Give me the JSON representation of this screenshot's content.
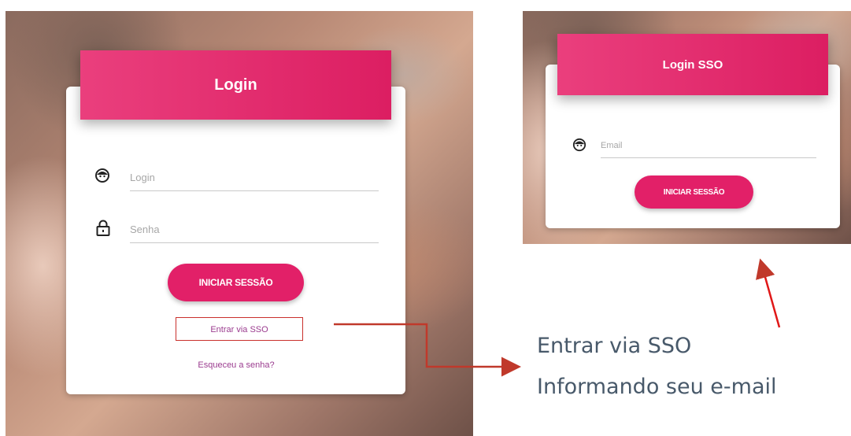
{
  "login_card": {
    "title": "Login",
    "login_placeholder": "Login",
    "password_placeholder": "Senha",
    "submit_label": "INICIAR SESSÃO",
    "sso_link": "Entrar via SSO",
    "forgot_link": "Esqueceu a senha?"
  },
  "sso_card": {
    "title": "Login SSO",
    "email_placeholder": "Email",
    "submit_label": "INICIAR SESSÃO"
  },
  "annotation": {
    "line1": "Entrar via SSO",
    "line2": "Informando seu e-mail"
  },
  "colors": {
    "accent": "#e22068",
    "header_gradient_start": "#ea3f7d",
    "header_gradient_end": "#dc1e62",
    "link": "#9b3c8f",
    "annotation_red": "#c0392b",
    "annotation_text": "#48596a"
  },
  "icons": {
    "user": "face-icon",
    "password": "lock-icon"
  }
}
